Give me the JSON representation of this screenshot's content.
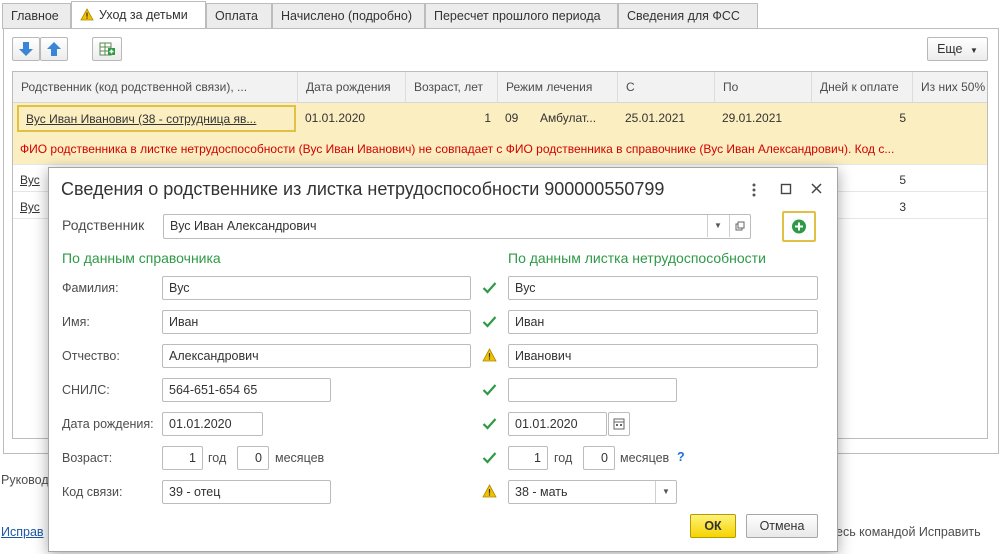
{
  "tabs": [
    "Главное",
    "Уход за детьми",
    "Оплата",
    "Начислено (подробно)",
    "Пересчет прошлого периода",
    "Сведения для ФСС"
  ],
  "toolbar": {
    "more_label": "Еще"
  },
  "grid": {
    "headers": [
      "Родственник (код родственной связи), ...",
      "Дата рождения",
      "Возраст, лет",
      "Режим лечения",
      "С",
      "По",
      "Дней к оплате",
      "Из них 50%"
    ],
    "row1": {
      "relative": "Вус Иван Иванович (38 - сотрудница яв...",
      "birth": "01.01.2020",
      "age": "1",
      "mode_code": "09",
      "mode": "Амбулат...",
      "from": "25.01.2021",
      "to": "29.01.2021",
      "days": "5"
    },
    "error_text": "ФИО родственника в листке нетрудоспособности (Вус Иван Иванович) не совпадает с ФИО родственника в справочнике (Вус Иван Александрович). Код с...",
    "row2": {
      "relative": "Вус",
      "days": "5"
    },
    "row3": {
      "relative": "Вус",
      "days": "3"
    }
  },
  "bottom": {
    "left_label": "Руковод",
    "link_left": "Исправ",
    "link_right": "есь командой Исправить"
  },
  "dialog": {
    "title": "Сведения о родственнике из листка нетрудоспособности 900000550799",
    "relative_label": "Родственник",
    "relative_value": "Вус Иван Александрович",
    "left_header": "По данным справочника",
    "right_header": "По данным листка нетрудоспособности",
    "labels": {
      "surname": "Фамилия:",
      "name": "Имя:",
      "patronymic": "Отчество:",
      "snils": "СНИЛС:",
      "birth": "Дата рождения:",
      "age": "Возраст:",
      "relation": "Код связи:"
    },
    "left": {
      "surname": "Вус",
      "name": "Иван",
      "patronymic": "Александрович",
      "snils": "564-651-654 65",
      "birth": "01.01.2020",
      "age_years": "1",
      "age_months": "0",
      "relation": "39 - отец"
    },
    "right": {
      "surname": "Вус",
      "name": "Иван",
      "patronymic": "Иванович",
      "snils": "",
      "birth": "01.01.2020",
      "age_years": "1",
      "age_months": "0",
      "relation": "38 - мать"
    },
    "year_unit": "год",
    "month_unit": "месяцев",
    "help_mark": "?",
    "ok_label": "ОК",
    "cancel_label": "Отмена"
  },
  "colors": {
    "accent_green": "#2e9a46",
    "error_red": "#d40000",
    "row_highlight": "#fbeec1",
    "ok_yellow": "#f5d400"
  }
}
